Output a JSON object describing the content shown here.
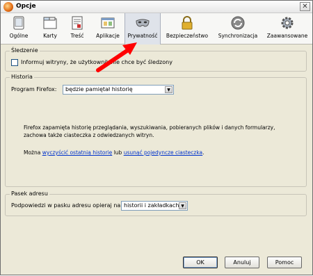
{
  "window": {
    "title": "Opcje",
    "close_symbol": "✕"
  },
  "toolbar": {
    "items": [
      {
        "label": "Ogólne",
        "icon": "general-icon"
      },
      {
        "label": "Karty",
        "icon": "tabs-icon"
      },
      {
        "label": "Treść",
        "icon": "content-icon"
      },
      {
        "label": "Aplikacje",
        "icon": "applications-icon"
      },
      {
        "label": "Prywatność",
        "icon": "privacy-mask-icon",
        "active": true
      },
      {
        "label": "Bezpieczeństwo",
        "icon": "security-lock-icon"
      },
      {
        "label": "Synchronizacja",
        "icon": "sync-icon"
      },
      {
        "label": "Zaawansowane",
        "icon": "advanced-gear-icon"
      }
    ]
  },
  "tracking": {
    "legend": "Śledzenie",
    "checkbox_label": "Informuj witryny, że użytkownik nie chce być śledzony",
    "checked": false
  },
  "history": {
    "legend": "Historia",
    "program_label": "Program Firefox:",
    "mode_value": "będzie pamiętał historię",
    "desc_line1": "Firefox zapamięta historię przeglądania, wyszukiwania, pobieranych plików i danych formularzy,",
    "desc_line2": "zachowa także ciasteczka z odwiedzanych witryn.",
    "may_text": "Można",
    "clear_link": "wyczyścić ostatnią historię",
    "or_text": "lub",
    "remove_link": "usunąć pojedyncze ciasteczka",
    "period": "."
  },
  "location_bar": {
    "legend": "Pasek adresu",
    "suggest_label": "Podpowiedzi w pasku adresu opieraj na:",
    "suggest_value": "historii i zakładkach"
  },
  "buttons": {
    "ok": "OK",
    "cancel": "Anuluj",
    "help": "Pomoc"
  },
  "colors": {
    "annotation_arrow": "#ff0000",
    "link": "#0033cc",
    "dialog_bg": "#ece9d8"
  }
}
